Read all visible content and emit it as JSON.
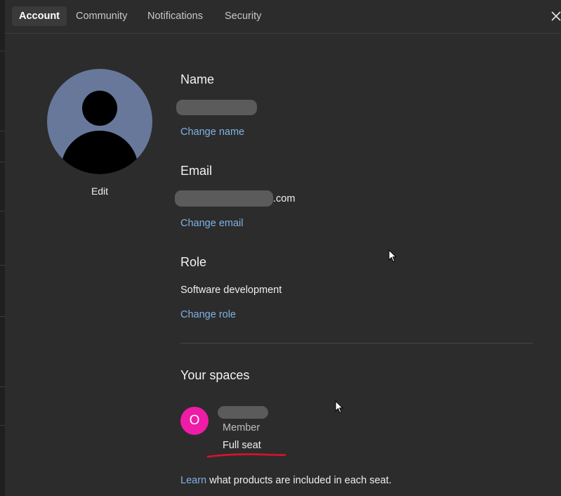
{
  "tabs": [
    {
      "label": "Account",
      "active": true
    },
    {
      "label": "Community",
      "active": false
    },
    {
      "label": "Notifications",
      "active": false
    },
    {
      "label": "Security",
      "active": false
    }
  ],
  "icons": {
    "close": "close-icon",
    "avatar": "user-silhouette-icon",
    "cursor": "mouse-pointer-icon"
  },
  "profile": {
    "edit_label": "Edit"
  },
  "name_section": {
    "title": "Name",
    "value_redacted": true,
    "change_label": "Change name"
  },
  "email_section": {
    "title": "Email",
    "value_suffix": ".com",
    "change_label": "Change email"
  },
  "role_section": {
    "title": "Role",
    "value": "Software development",
    "change_label": "Change role"
  },
  "spaces_section": {
    "title": "Your spaces",
    "space": {
      "initial": "O",
      "name_redacted": true,
      "membership": "Member",
      "seat": "Full seat"
    }
  },
  "footer": {
    "link_label": "Learn",
    "text": " what products are included in each seat."
  },
  "colors": {
    "background": "#2c2c2c",
    "link": "#7fb2e5",
    "avatar_bg": "#67789b",
    "space_avatar_bg": "#ee1ca6",
    "annotation": "#e0102a"
  }
}
